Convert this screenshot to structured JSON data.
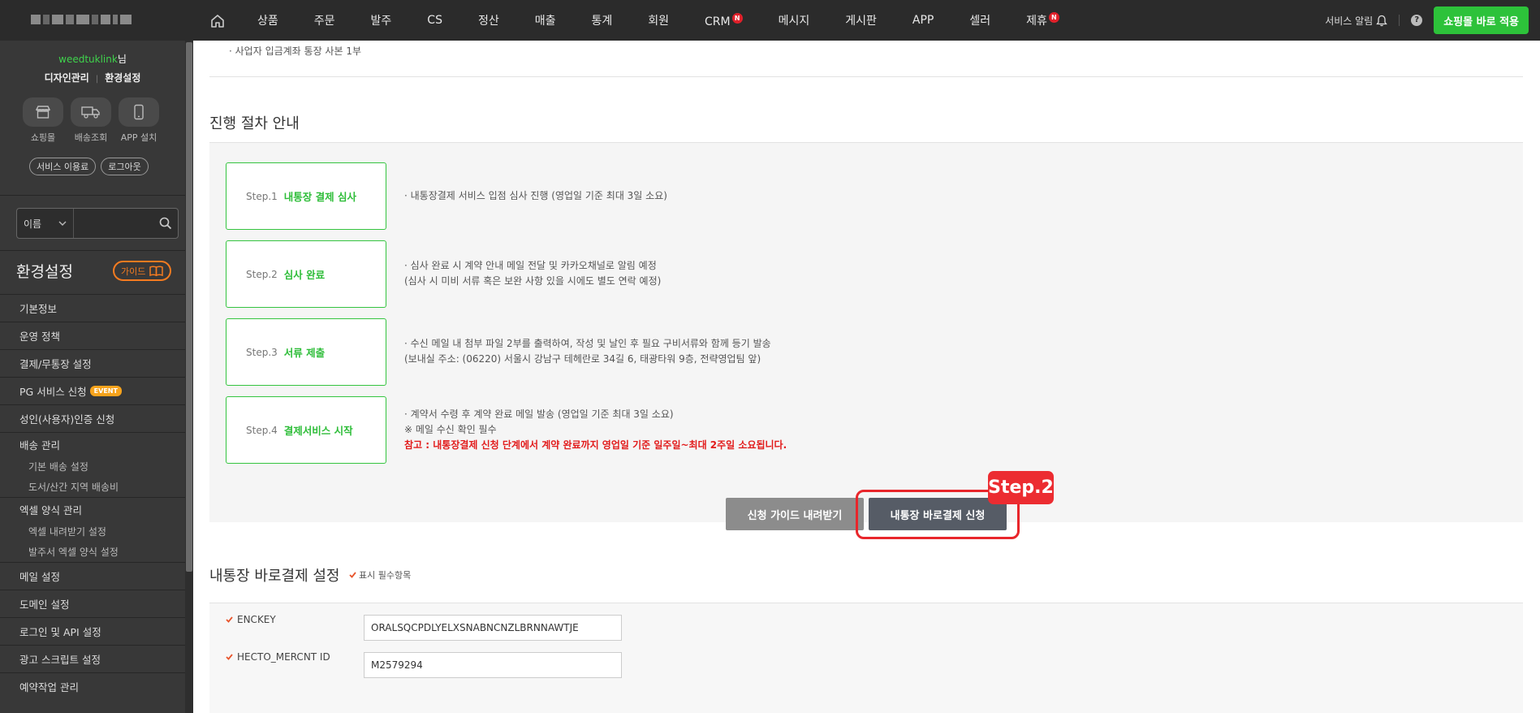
{
  "topnav": {
    "items": [
      "상품",
      "주문",
      "발주",
      "CS",
      "정산",
      "매출",
      "통계",
      "회원",
      "CRM",
      "메시지",
      "게시판",
      "APP",
      "셀러",
      "제휴"
    ],
    "badge_letter": "N",
    "service_alert": "서비스 알림",
    "help": "?",
    "apply_button": "쇼핑몰 바로 적용"
  },
  "sidebar": {
    "user_id": "weedtuklink",
    "user_suffix": "님",
    "link_design": "디자인관리",
    "link_sep": "|",
    "link_env": "환경설정",
    "quick": [
      {
        "label": "쇼핑몰",
        "icon": "store-icon"
      },
      {
        "label": "배송조회",
        "icon": "truck-icon"
      },
      {
        "label": "APP 설치",
        "icon": "phone-icon"
      }
    ],
    "pill_fee": "서비스 이용료",
    "pill_logout": "로그아웃",
    "search_select": "이름",
    "search_value": "",
    "section_title": "환경설정",
    "guide_label": "가이드",
    "menu": {
      "basic_info": "기본정보",
      "policy": "운영 정책",
      "payment": "결제/무통장 설정",
      "pg": "PG 서비스 신청",
      "pg_badge": "EVENT",
      "adult": "성인(사용자)인증 신청",
      "delivery": "배송 관리",
      "delivery_basic": "기본 배송 설정",
      "delivery_island": "도서/산간 지역 배송비",
      "excel": "엑셀 양식 관리",
      "excel_download": "엑셀 내려받기 설정",
      "excel_order": "발주서 엑셀 양식 설정",
      "mail": "메일 설정",
      "domain": "도메인 설정",
      "login_api": "로그인 및 API 설정",
      "ad_script": "광고 스크립트 설정",
      "reserve": "예약작업 관리"
    }
  },
  "main": {
    "top_note": "· 사업자 입금계좌 통장 사본 1부",
    "process_title": "진행 절차 안내",
    "steps": [
      {
        "num": "Step.1",
        "name": "내통장 결제 심사",
        "lines": [
          "· 내통장결제 서비스 입점 심사 진행 (영업일 기준 최대 3일 소요)"
        ]
      },
      {
        "num": "Step.2",
        "name": "심사 완료",
        "lines": [
          "· 심사 완료 시 계약 안내 메일 전달 및 카카오채널로 알림 예정",
          "(심사 시 미비 서류 혹은 보완 사항 있을 시에도 별도 연락 예정)"
        ]
      },
      {
        "num": "Step.3",
        "name": "서류 제출",
        "lines": [
          "· 수신 메일 내 첨부 파일 2부를 출력하여, 작성 및 날인 후 필요 구비서류와 함께 등기 발송",
          "(보내실 주소: (06220) 서울시 강남구 테헤란로 34길 6, 태광타워 9층, 전략영업팀 앞)"
        ]
      },
      {
        "num": "Step.4",
        "name": "결제서비스 시작",
        "lines": [
          "· 계약서 수령 후 계약 완료 메일 발송 (영업일 기준 최대 3일 소요)",
          "※ 메일 수신 확인 필수"
        ],
        "note": "참고 : 내통장결제 신청 단계에서 계약 완료까지 영업일 기준 일주일~최대 2주일 소요됩니다."
      }
    ],
    "btn_guide": "신청 가이드 내려받기",
    "btn_apply": "내통장 바로결제 신청",
    "callout": "Step.2",
    "settings_title": "내통장 바로결제 설정",
    "required_note": "표시 필수항목",
    "fields": [
      {
        "label": "ENCKEY",
        "value": "ORALSQCPDLYELXSNABNCNZLBRNNAWTJE"
      },
      {
        "label": "HECTO_MERCNT ID",
        "value": "M2579294"
      }
    ]
  },
  "colors": {
    "accent_green": "#2dc23a",
    "step_green": "#2dbd38",
    "highlight_red": "#e8262b",
    "guide_orange": "#f47b20",
    "topbar_bg": "#2b2b2b",
    "sidebar_bg": "#383838"
  }
}
